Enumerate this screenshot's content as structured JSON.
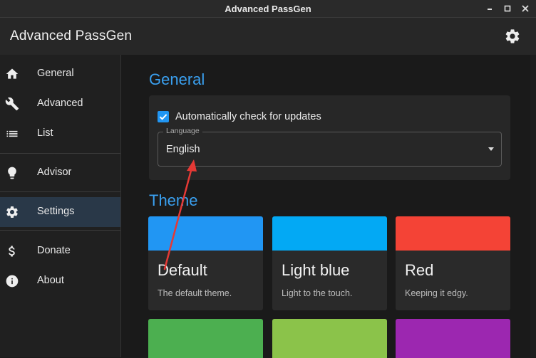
{
  "window": {
    "title": "Advanced PassGen"
  },
  "appbar": {
    "title": "Advanced PassGen",
    "settings_icon": "gear-icon"
  },
  "sidebar": {
    "items": [
      {
        "label": "General",
        "icon": "home-icon"
      },
      {
        "label": "Advanced",
        "icon": "wrench-icon"
      },
      {
        "label": "List",
        "icon": "list-icon"
      },
      {
        "label": "Advisor",
        "icon": "lightbulb-icon"
      },
      {
        "label": "Settings",
        "icon": "gear-icon",
        "active": true
      },
      {
        "label": "Donate",
        "icon": "dollar-icon"
      },
      {
        "label": "About",
        "icon": "info-icon"
      }
    ]
  },
  "general": {
    "title": "General",
    "auto_update_label": "Automatically check for updates",
    "auto_update_checked": true,
    "language_label": "Language",
    "language_value": "English"
  },
  "theme": {
    "title": "Theme",
    "cards": [
      {
        "name": "Default",
        "description": "The default theme.",
        "color": "#2196f3"
      },
      {
        "name": "Light blue",
        "description": "Light to the touch.",
        "color": "#03a9f4"
      },
      {
        "name": "Red",
        "description": "Keeping it edgy.",
        "color": "#f44336"
      }
    ],
    "more_colors": [
      "#4caf50",
      "#8bc34a",
      "#9c27b0"
    ]
  },
  "colors": {
    "accent": "#2196f3",
    "annotation_arrow": "#e53935",
    "active_nav": "#293848"
  }
}
